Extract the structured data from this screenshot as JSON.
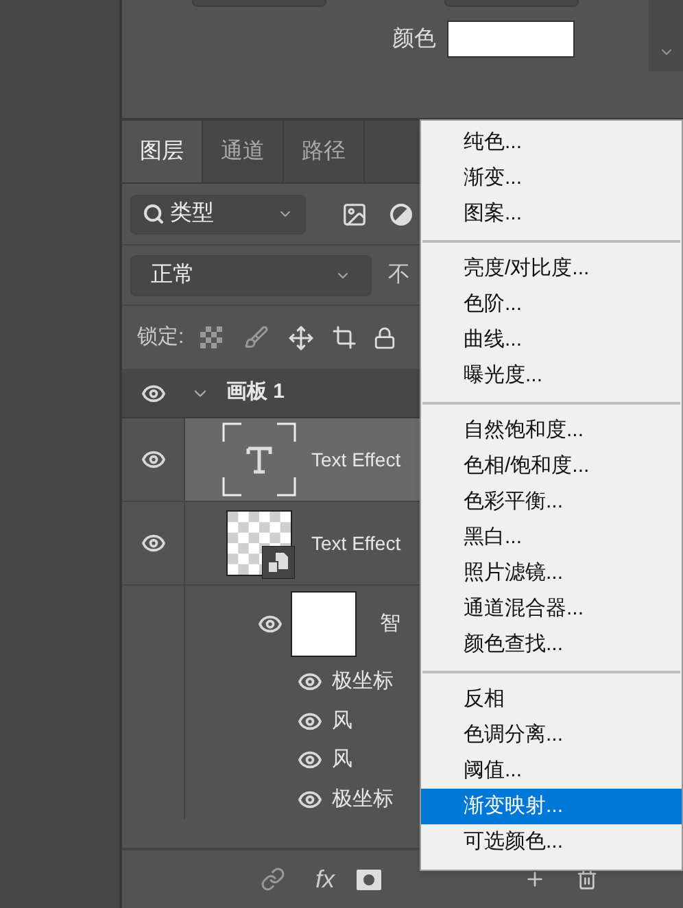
{
  "properties": {
    "color_label": "颜色"
  },
  "tabs": [
    {
      "label": "图层",
      "selected": true
    },
    {
      "label": "通道",
      "selected": false
    },
    {
      "label": "路径",
      "selected": false
    }
  ],
  "filter": {
    "value": "类型"
  },
  "blend": {
    "value": "正常",
    "opacity_label": "不"
  },
  "lock_label": "锁定:",
  "layers": [
    {
      "kind": "group",
      "name": "画板 1",
      "expanded": true,
      "children": [
        {
          "kind": "text",
          "name": "Text Effect",
          "selected": true
        },
        {
          "kind": "smart",
          "name": "Text Effect",
          "selected": false,
          "children": [
            {
              "kind": "smart_filters",
              "name": "智",
              "children": [
                {
                  "kind": "filter",
                  "name": "极坐标"
                },
                {
                  "kind": "filter",
                  "name": "风"
                },
                {
                  "kind": "filter",
                  "name": "风"
                },
                {
                  "kind": "filter",
                  "name": "极坐标"
                }
              ]
            }
          ]
        }
      ]
    }
  ],
  "bottom_bar": {
    "fx_label": "fx"
  },
  "menu": [
    [
      {
        "label": "纯色...",
        "selected": false
      },
      {
        "label": "渐变...",
        "selected": false
      },
      {
        "label": "图案...",
        "selected": false
      }
    ],
    [
      {
        "label": "亮度/对比度...",
        "selected": false
      },
      {
        "label": "色阶...",
        "selected": false
      },
      {
        "label": "曲线...",
        "selected": false
      },
      {
        "label": "曝光度...",
        "selected": false
      }
    ],
    [
      {
        "label": "自然饱和度...",
        "selected": false
      },
      {
        "label": "色相/饱和度...",
        "selected": false
      },
      {
        "label": "色彩平衡...",
        "selected": false
      },
      {
        "label": "黑白...",
        "selected": false
      },
      {
        "label": "照片滤镜...",
        "selected": false
      },
      {
        "label": "通道混合器...",
        "selected": false
      },
      {
        "label": "颜色查找...",
        "selected": false
      }
    ],
    [
      {
        "label": "反相",
        "selected": false
      },
      {
        "label": "色调分离...",
        "selected": false
      },
      {
        "label": "阈值...",
        "selected": false
      },
      {
        "label": "渐变映射...",
        "selected": true
      },
      {
        "label": "可选颜色...",
        "selected": false
      }
    ]
  ]
}
